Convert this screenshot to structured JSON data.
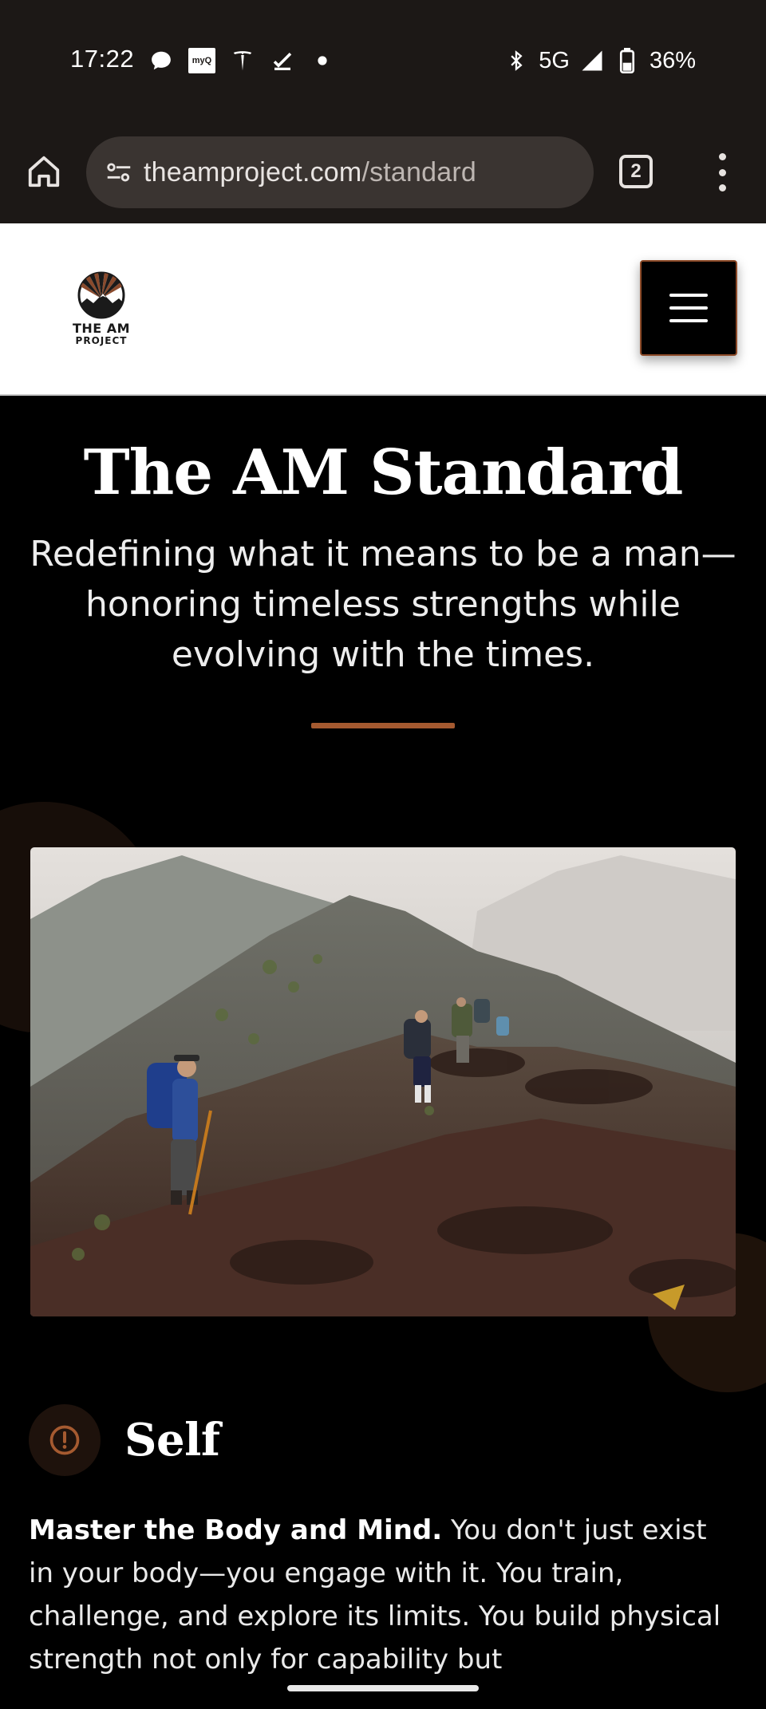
{
  "status_bar": {
    "time": "17:22",
    "left_icons": [
      "chat-bubble-icon",
      "myq-icon",
      "tesla-icon",
      "download-done-icon",
      "dot-icon"
    ],
    "myq_text": "myQ",
    "network": "5G",
    "battery": "36%"
  },
  "browser": {
    "url_domain": "theamproject.com",
    "url_path": "/standard",
    "tab_count": "2"
  },
  "site": {
    "logo_line1": "THE AM",
    "logo_line2": "PROJECT",
    "accent_color": "#a55a30"
  },
  "hero": {
    "title": "The AM Standard",
    "subtitle": "Redefining what it means to be a man—honoring timeless strengths while evolving with the times."
  },
  "section": {
    "icon": "alert-circle-icon",
    "title": "Self",
    "lead": "Master the Body and Mind.",
    "body": " You don't just exist in your body—you engage with it. You train, challenge, and explore its limits. You build physical strength not only for capability but"
  }
}
